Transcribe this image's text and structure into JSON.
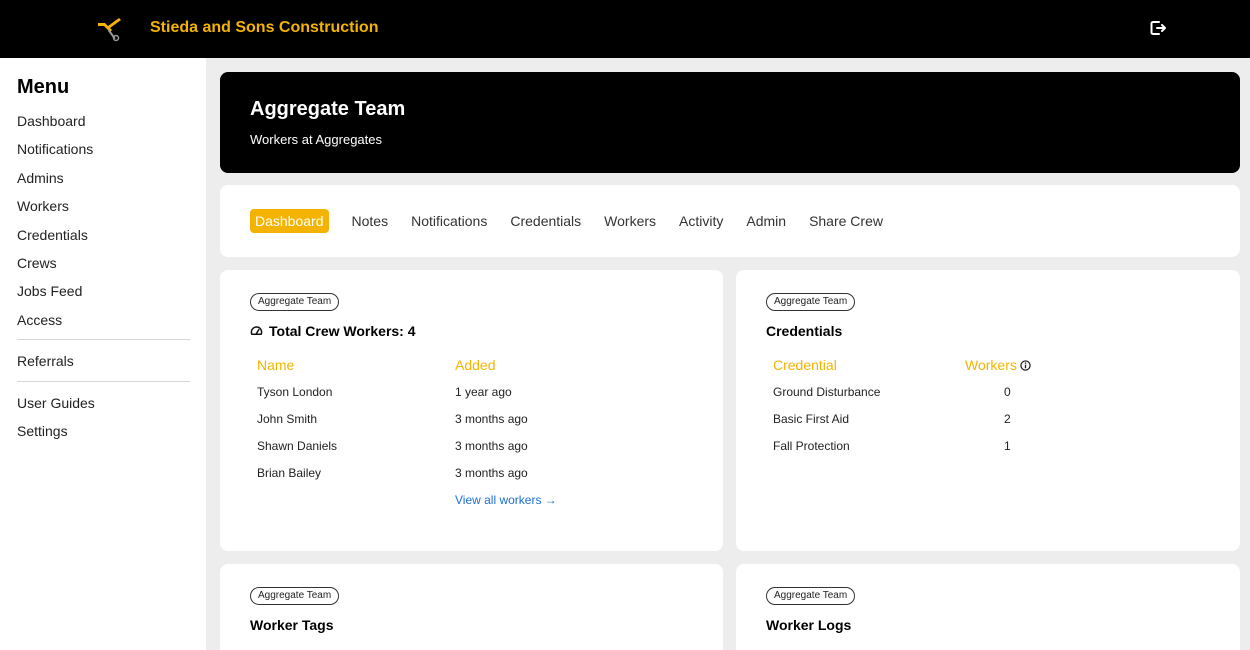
{
  "header": {
    "brand": "Stieda and Sons Construction",
    "logo_icon": "wrench-and-hammer-icon",
    "logout_icon": "logout-icon",
    "brand_color": "#f5b301"
  },
  "sidebar": {
    "title": "Menu",
    "items": [
      "Dashboard",
      "Notifications",
      "Admins",
      "Workers",
      "Credentials",
      "Crews",
      "Jobs Feed",
      "Access"
    ],
    "items2": [
      "Referrals"
    ],
    "items3": [
      "User Guides",
      "Settings"
    ]
  },
  "hero": {
    "title": "Aggregate Team",
    "subtitle": "Workers at Aggregates"
  },
  "tabs": [
    "Dashboard",
    "Notes",
    "Notifications",
    "Credentials",
    "Workers",
    "Activity",
    "Admin",
    "Share Crew"
  ],
  "crew_card": {
    "pill": "Aggregate Team",
    "title": "Total Crew Workers: 4",
    "icon": "speedometer-icon",
    "col_name": "Name",
    "col_added": "Added",
    "rows": [
      {
        "name": "Tyson London",
        "added": "1 year ago"
      },
      {
        "name": "John Smith",
        "added": "3 months ago"
      },
      {
        "name": "Shawn Daniels",
        "added": "3 months ago"
      },
      {
        "name": "Brian Bailey",
        "added": "3 months ago"
      }
    ],
    "view_all": "View all workers →"
  },
  "cred_card": {
    "pill": "Aggregate Team",
    "title": "Credentials",
    "col_credential": "Credential",
    "col_workers": "Workers",
    "info_icon": "info-icon",
    "rows": [
      {
        "credential": "Ground Disturbance",
        "workers": "0"
      },
      {
        "credential": "Basic First Aid",
        "workers": "2"
      },
      {
        "credential": "Fall Protection",
        "workers": "1"
      }
    ]
  },
  "tags_card": {
    "pill": "Aggregate Team",
    "title": "Worker Tags"
  },
  "logs_card": {
    "pill": "Aggregate Team",
    "title": "Worker Logs"
  }
}
